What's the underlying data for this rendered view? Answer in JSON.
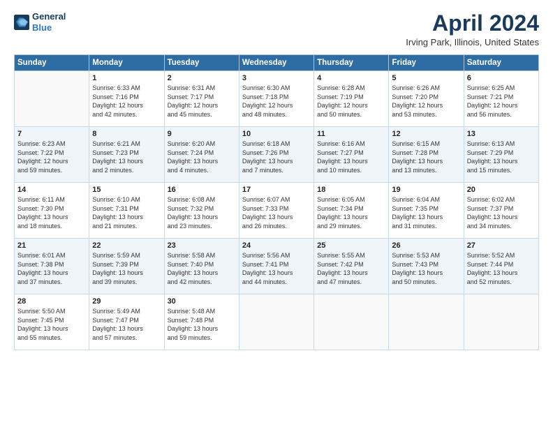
{
  "header": {
    "logo_line1": "General",
    "logo_line2": "Blue",
    "title": "April 2024",
    "subtitle": "Irving Park, Illinois, United States"
  },
  "days_of_week": [
    "Sunday",
    "Monday",
    "Tuesday",
    "Wednesday",
    "Thursday",
    "Friday",
    "Saturday"
  ],
  "weeks": [
    [
      {
        "day": "",
        "content": ""
      },
      {
        "day": "1",
        "content": "Sunrise: 6:33 AM\nSunset: 7:16 PM\nDaylight: 12 hours\nand 42 minutes."
      },
      {
        "day": "2",
        "content": "Sunrise: 6:31 AM\nSunset: 7:17 PM\nDaylight: 12 hours\nand 45 minutes."
      },
      {
        "day": "3",
        "content": "Sunrise: 6:30 AM\nSunset: 7:18 PM\nDaylight: 12 hours\nand 48 minutes."
      },
      {
        "day": "4",
        "content": "Sunrise: 6:28 AM\nSunset: 7:19 PM\nDaylight: 12 hours\nand 50 minutes."
      },
      {
        "day": "5",
        "content": "Sunrise: 6:26 AM\nSunset: 7:20 PM\nDaylight: 12 hours\nand 53 minutes."
      },
      {
        "day": "6",
        "content": "Sunrise: 6:25 AM\nSunset: 7:21 PM\nDaylight: 12 hours\nand 56 minutes."
      }
    ],
    [
      {
        "day": "7",
        "content": "Sunrise: 6:23 AM\nSunset: 7:22 PM\nDaylight: 12 hours\nand 59 minutes."
      },
      {
        "day": "8",
        "content": "Sunrise: 6:21 AM\nSunset: 7:23 PM\nDaylight: 13 hours\nand 2 minutes."
      },
      {
        "day": "9",
        "content": "Sunrise: 6:20 AM\nSunset: 7:24 PM\nDaylight: 13 hours\nand 4 minutes."
      },
      {
        "day": "10",
        "content": "Sunrise: 6:18 AM\nSunset: 7:26 PM\nDaylight: 13 hours\nand 7 minutes."
      },
      {
        "day": "11",
        "content": "Sunrise: 6:16 AM\nSunset: 7:27 PM\nDaylight: 13 hours\nand 10 minutes."
      },
      {
        "day": "12",
        "content": "Sunrise: 6:15 AM\nSunset: 7:28 PM\nDaylight: 13 hours\nand 13 minutes."
      },
      {
        "day": "13",
        "content": "Sunrise: 6:13 AM\nSunset: 7:29 PM\nDaylight: 13 hours\nand 15 minutes."
      }
    ],
    [
      {
        "day": "14",
        "content": "Sunrise: 6:11 AM\nSunset: 7:30 PM\nDaylight: 13 hours\nand 18 minutes."
      },
      {
        "day": "15",
        "content": "Sunrise: 6:10 AM\nSunset: 7:31 PM\nDaylight: 13 hours\nand 21 minutes."
      },
      {
        "day": "16",
        "content": "Sunrise: 6:08 AM\nSunset: 7:32 PM\nDaylight: 13 hours\nand 23 minutes."
      },
      {
        "day": "17",
        "content": "Sunrise: 6:07 AM\nSunset: 7:33 PM\nDaylight: 13 hours\nand 26 minutes."
      },
      {
        "day": "18",
        "content": "Sunrise: 6:05 AM\nSunset: 7:34 PM\nDaylight: 13 hours\nand 29 minutes."
      },
      {
        "day": "19",
        "content": "Sunrise: 6:04 AM\nSunset: 7:35 PM\nDaylight: 13 hours\nand 31 minutes."
      },
      {
        "day": "20",
        "content": "Sunrise: 6:02 AM\nSunset: 7:37 PM\nDaylight: 13 hours\nand 34 minutes."
      }
    ],
    [
      {
        "day": "21",
        "content": "Sunrise: 6:01 AM\nSunset: 7:38 PM\nDaylight: 13 hours\nand 37 minutes."
      },
      {
        "day": "22",
        "content": "Sunrise: 5:59 AM\nSunset: 7:39 PM\nDaylight: 13 hours\nand 39 minutes."
      },
      {
        "day": "23",
        "content": "Sunrise: 5:58 AM\nSunset: 7:40 PM\nDaylight: 13 hours\nand 42 minutes."
      },
      {
        "day": "24",
        "content": "Sunrise: 5:56 AM\nSunset: 7:41 PM\nDaylight: 13 hours\nand 44 minutes."
      },
      {
        "day": "25",
        "content": "Sunrise: 5:55 AM\nSunset: 7:42 PM\nDaylight: 13 hours\nand 47 minutes."
      },
      {
        "day": "26",
        "content": "Sunrise: 5:53 AM\nSunset: 7:43 PM\nDaylight: 13 hours\nand 50 minutes."
      },
      {
        "day": "27",
        "content": "Sunrise: 5:52 AM\nSunset: 7:44 PM\nDaylight: 13 hours\nand 52 minutes."
      }
    ],
    [
      {
        "day": "28",
        "content": "Sunrise: 5:50 AM\nSunset: 7:45 PM\nDaylight: 13 hours\nand 55 minutes."
      },
      {
        "day": "29",
        "content": "Sunrise: 5:49 AM\nSunset: 7:47 PM\nDaylight: 13 hours\nand 57 minutes."
      },
      {
        "day": "30",
        "content": "Sunrise: 5:48 AM\nSunset: 7:48 PM\nDaylight: 13 hours\nand 59 minutes."
      },
      {
        "day": "",
        "content": ""
      },
      {
        "day": "",
        "content": ""
      },
      {
        "day": "",
        "content": ""
      },
      {
        "day": "",
        "content": ""
      }
    ]
  ]
}
